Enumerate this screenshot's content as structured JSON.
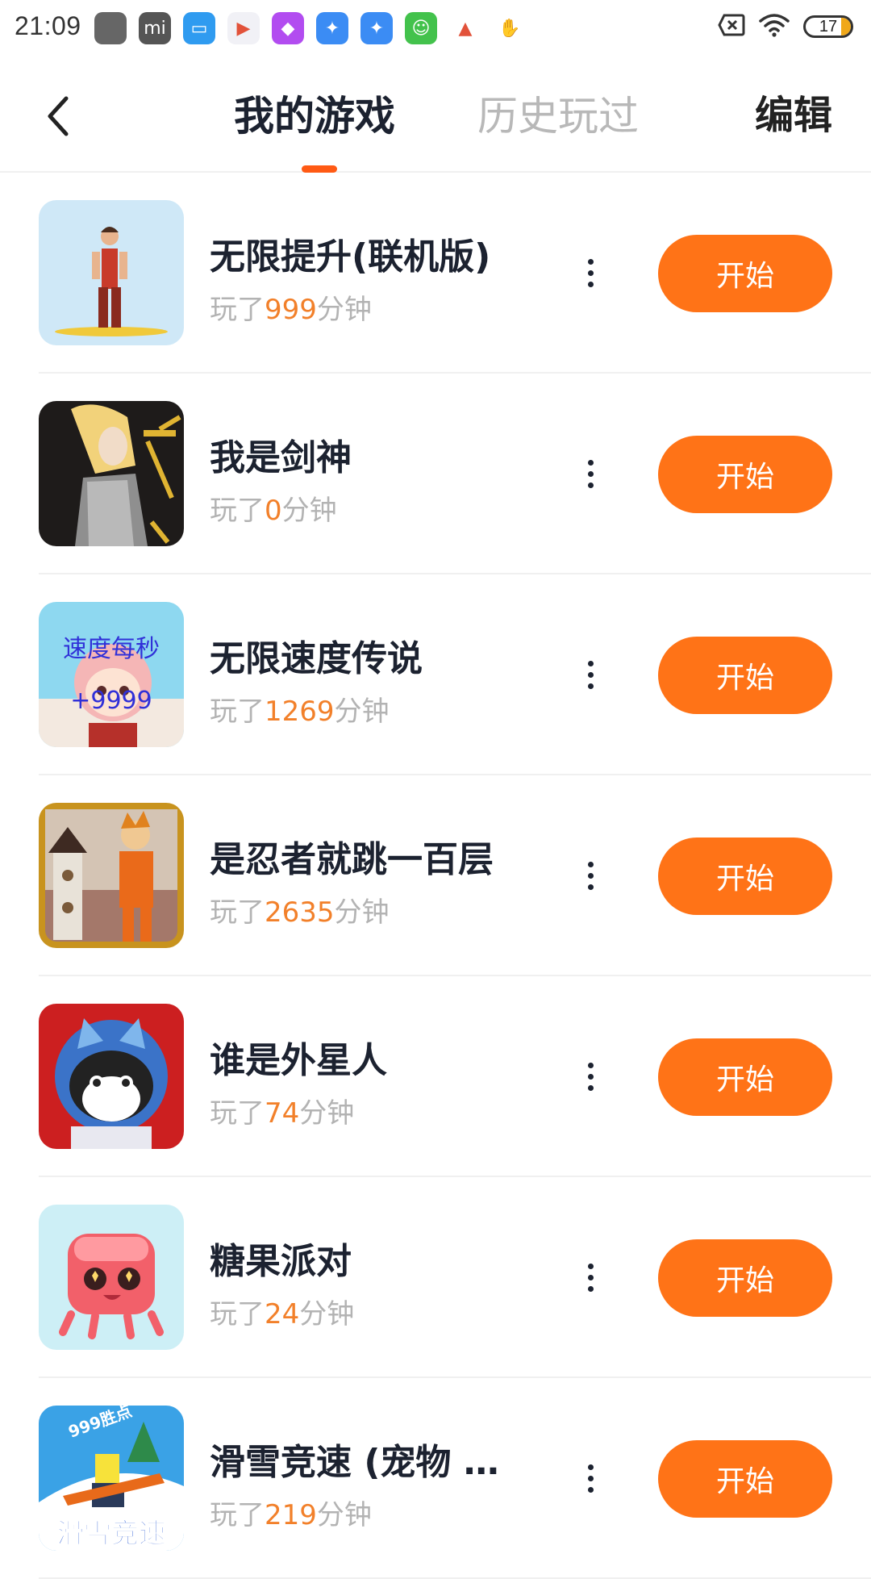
{
  "status_bar": {
    "time": "21:09",
    "battery": "17",
    "notification_icons": [
      {
        "name": "app-icon-gray",
        "color": "#666666",
        "glyph": ""
      },
      {
        "name": "mi-icon",
        "color": "#555555",
        "glyph": "mi"
      },
      {
        "name": "wallet-icon",
        "color": "#2f9bf0",
        "glyph": "▭"
      },
      {
        "name": "video-play-icon",
        "color": "#f1f1f6",
        "glyph": "▶"
      },
      {
        "name": "gallery-icon",
        "color": "#b24cf0",
        "glyph": "◆"
      },
      {
        "name": "cleaner-icon",
        "color": "#3b8cf4",
        "glyph": "✦"
      },
      {
        "name": "cleaner-icon-2",
        "color": "#3b8cf4",
        "glyph": "✦"
      },
      {
        "name": "android-robot-icon",
        "color": "#43c24c",
        "glyph": "☺"
      },
      {
        "name": "prism-icon",
        "color": "#ffffff",
        "glyph": "▲"
      },
      {
        "name": "game-mascot-icon",
        "color": "#ffffff",
        "glyph": "✋"
      }
    ]
  },
  "header": {
    "tab_active": "我的游戏",
    "tab_inactive": "历史玩过",
    "edit_label": "编辑"
  },
  "colors": {
    "accent": "#ff7317",
    "indicator": "#ff5a14",
    "minutes": "#f2802a"
  },
  "games": [
    {
      "title": "无限提升(联机版)",
      "played_prefix": "玩了",
      "minutes": "999",
      "played_suffix": "分钟",
      "start_label": "开始",
      "icon": "runner-on-board"
    },
    {
      "title": "我是剑神",
      "played_prefix": "玩了",
      "minutes": "0",
      "played_suffix": "分钟",
      "start_label": "开始",
      "icon": "sword-hero"
    },
    {
      "title": "无限速度传说",
      "played_prefix": "玩了",
      "minutes": "1269",
      "played_suffix": "分钟",
      "start_label": "开始",
      "icon": "speed-anime-girl",
      "icon_text_1": "速度每秒",
      "icon_text_2": "+9999"
    },
    {
      "title": "是忍者就跳一百层",
      "played_prefix": "玩了",
      "minutes": "2635",
      "played_suffix": "分钟",
      "start_label": "开始",
      "icon": "ninja-tower"
    },
    {
      "title": "谁是外星人",
      "played_prefix": "玩了",
      "minutes": "74",
      "played_suffix": "分钟",
      "start_label": "开始",
      "icon": "astronaut-cat"
    },
    {
      "title": "糖果派对",
      "played_prefix": "玩了",
      "minutes": "24",
      "played_suffix": "分钟",
      "start_label": "开始",
      "icon": "jelly-candy"
    },
    {
      "title": "滑雪竞速 (宠物 重…",
      "played_prefix": "玩了",
      "minutes": "219",
      "played_suffix": "分钟",
      "start_label": "开始",
      "icon": "ski-racer",
      "icon_text_1": "999胜点",
      "icon_text_2": "滑雪竞速"
    }
  ]
}
